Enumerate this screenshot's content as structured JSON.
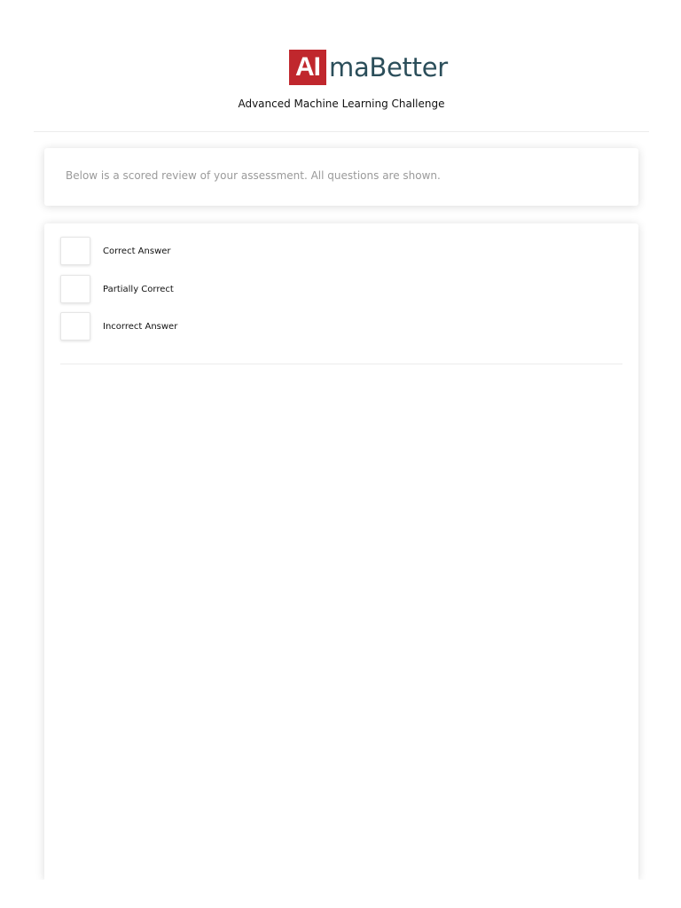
{
  "header": {
    "logo_badge": "AI",
    "logo_text": "maBetter",
    "subtitle": "Advanced Machine Learning Challenge"
  },
  "notice": {
    "text": "Below is a scored review of your assessment. All questions are shown."
  },
  "legend": {
    "items": [
      {
        "label": "Correct Answer"
      },
      {
        "label": "Partially Correct"
      },
      {
        "label": "Incorrect Answer"
      }
    ]
  },
  "colors": {
    "brand_red": "#c0272d",
    "brand_teal": "#2b4e5a"
  }
}
